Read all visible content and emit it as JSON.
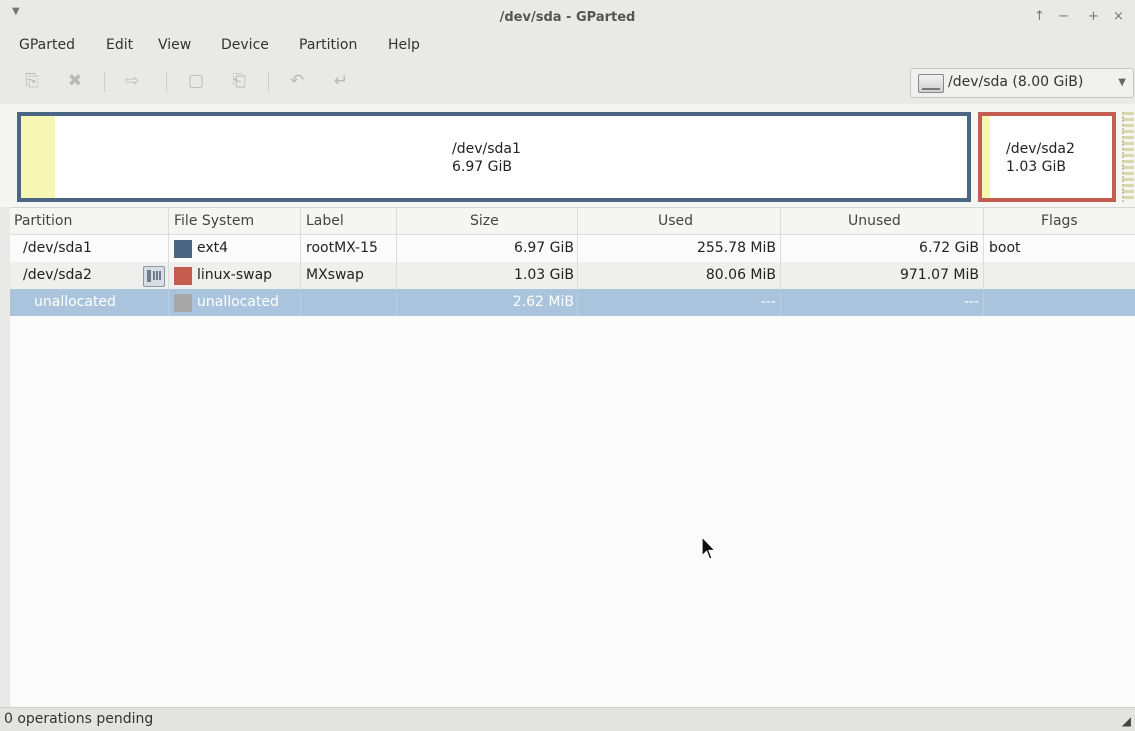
{
  "window": {
    "title": "/dev/sda - GParted",
    "controls": [
      "↑",
      "−",
      "+",
      "×"
    ]
  },
  "menu": [
    "GParted",
    "Edit",
    "View",
    "Device",
    "Partition",
    "Help"
  ],
  "toolbar": {
    "icons": [
      "new-partition-icon",
      "delete-icon",
      "resize-move-icon",
      "copy-icon",
      "paste-icon",
      "undo-icon",
      "apply-icon"
    ],
    "device": "/dev/sda  (8.00 GiB)"
  },
  "disk_map": {
    "partitions": [
      {
        "name": "/dev/sda1",
        "size": "6.97 GiB",
        "color": "#4a6683"
      },
      {
        "name": "/dev/sda2",
        "size": "1.03 GiB",
        "color": "#c55c50"
      }
    ],
    "used_color": "#f7f7b4"
  },
  "table": {
    "columns": [
      "Partition",
      "File System",
      "Label",
      "Size",
      "Used",
      "Unused",
      "Flags"
    ],
    "rows": [
      {
        "partition": "/dev/sda1",
        "fs": "ext4",
        "fs_color": "#4a6683",
        "label": "rootMX-15",
        "size": "6.97 GiB",
        "used": "255.78 MiB",
        "unused": "6.72 GiB",
        "flags": "boot"
      },
      {
        "partition": "/dev/sda2",
        "fs": "linux-swap",
        "fs_color": "#c55c50",
        "label": "MXswap",
        "size": "1.03 GiB",
        "used": "80.06 MiB",
        "unused": "971.07 MiB",
        "flags": ""
      },
      {
        "partition": "unallocated",
        "fs": "unallocated",
        "fs_color": "#a8a8a8",
        "label": "",
        "size": "2.62 MiB",
        "used": "---",
        "unused": "---",
        "flags": ""
      }
    ]
  },
  "status": {
    "text": "0 operations pending"
  }
}
